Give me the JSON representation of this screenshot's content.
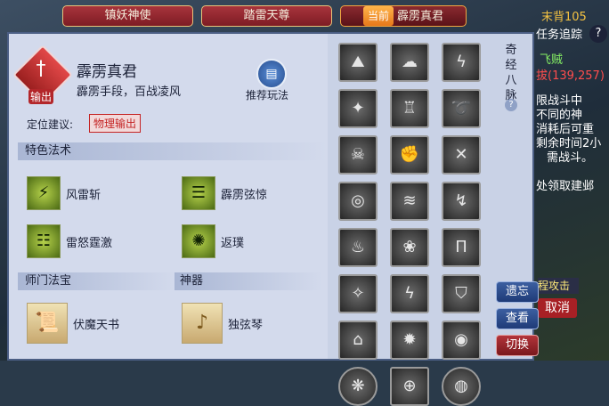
{
  "tabs": [
    {
      "label": "镇妖神使"
    },
    {
      "label": "踏雷天尊"
    },
    {
      "prefix": "当前",
      "label": "霹雳真君"
    }
  ],
  "school": {
    "name": "霹雳真君",
    "role": "输出",
    "description": "霹雳手段，百战凌风",
    "guide_label": "推荐玩法"
  },
  "position": {
    "label": "定位建议:",
    "badge": "物理输出"
  },
  "sections": {
    "skills_title": "特色法术",
    "treasure_title": "师门法宝",
    "artifact_title": "神器"
  },
  "skills": [
    {
      "label": "风雷斩",
      "glyph": "⚡"
    },
    {
      "label": "霹雳弦惊",
      "glyph": "☰"
    },
    {
      "label": "雷怒霆激",
      "glyph": "☷"
    },
    {
      "label": "返璞",
      "glyph": "✺"
    }
  ],
  "treasure": {
    "label": "伏魔天书",
    "icon": "scroll-icon"
  },
  "artifact": {
    "label": "独弦琴",
    "icon": "lute-icon"
  },
  "meridians_title": "奇经八脉",
  "grid_icons": [
    "mountain-icon",
    "cloud-icon",
    "lightning-icon",
    "wind-icon",
    "tower-icon",
    "spiral-icon",
    "skull-icon",
    "fist-icon",
    "cross-swords-icon",
    "mask-icon",
    "crack-icon",
    "bolt-icon",
    "flame-icon",
    "nest-icon",
    "gate-icon",
    "claw-icon",
    "storm-icon",
    "helm-icon",
    "crest-icon",
    "beast-icon",
    "coil-icon",
    "wave-icon",
    "sigil-icon",
    "coin-icon"
  ],
  "buttons": {
    "forget": "遗忘",
    "view": "查看",
    "switch": "切换"
  },
  "background": {
    "lines": [
      "末背105",
      "任务追踪",
      "飞贼",
      "拔(139,257)",
      "限战斗中",
      "不同的神",
      "消耗后可重",
      "剩余时间2小",
      "需战斗。",
      "处领取建邺"
    ],
    "panel_label": "程攻击",
    "cancel": "取消"
  }
}
